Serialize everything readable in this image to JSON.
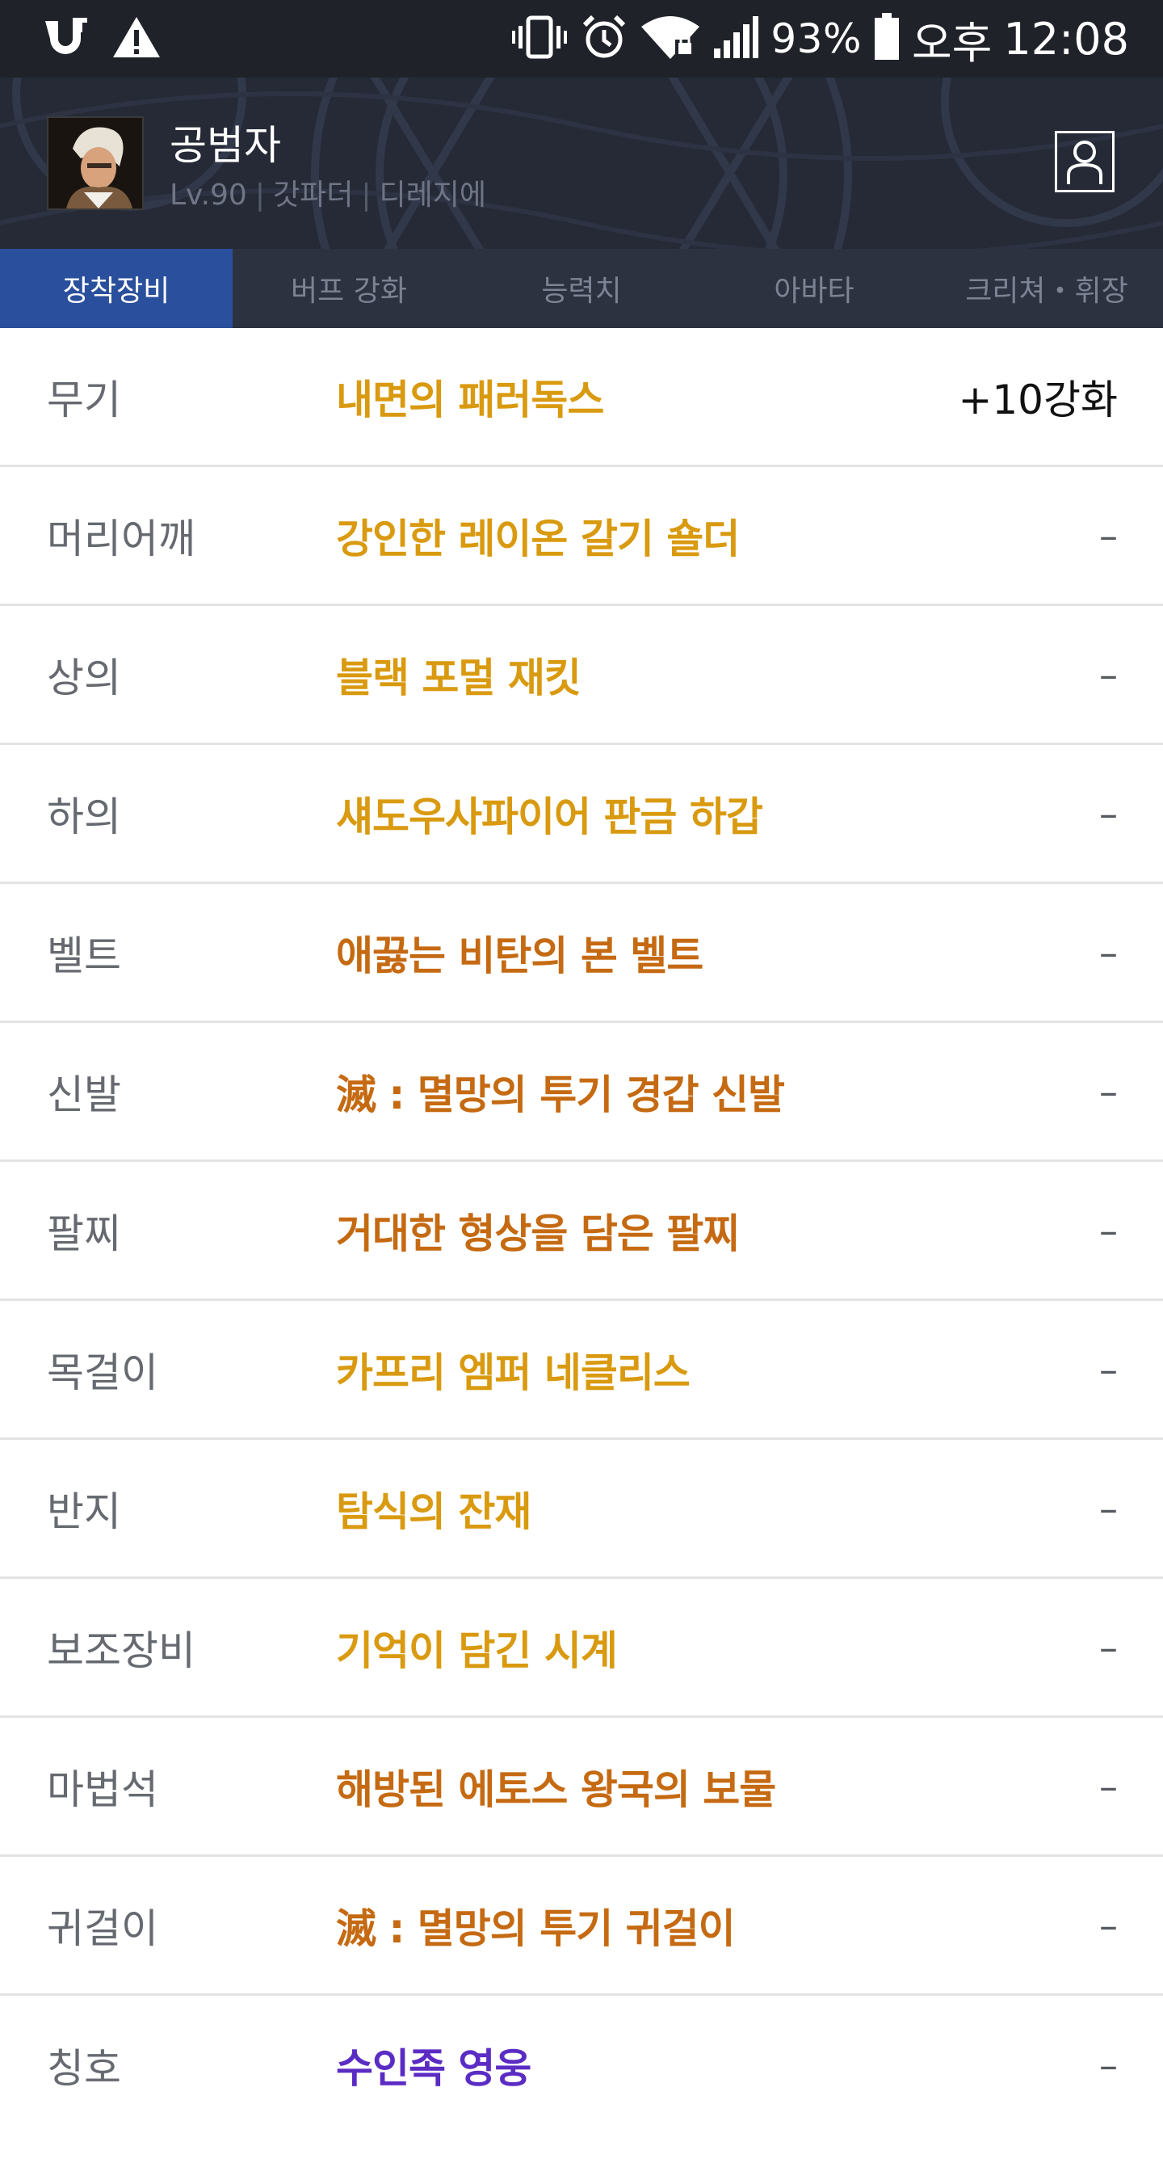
{
  "status_bar": {
    "battery_percent": "93%",
    "period": "오후",
    "time": "12:08"
  },
  "character": {
    "name": "공범자",
    "level": "Lv.90",
    "class": "갓파더",
    "server": "디레지에"
  },
  "tabs": [
    {
      "label": "장착장비",
      "active": true
    },
    {
      "label": "버프 강화",
      "active": false
    },
    {
      "label": "능력치",
      "active": false
    },
    {
      "label": "아바타",
      "active": false
    },
    {
      "label": "크리쳐・휘장",
      "active": false
    }
  ],
  "colors": {
    "legendary": "#d99a10",
    "epic": "#c56a12",
    "unique": "#5b2cc4"
  },
  "equipment": [
    {
      "slot": "무기",
      "item": "내면의 패러독스",
      "enhance": "+10강화",
      "color": "#d99a10"
    },
    {
      "slot": "머리어깨",
      "item": "강인한 레이온 갈기 숄더",
      "enhance": "–",
      "color": "#d99a10"
    },
    {
      "slot": "상의",
      "item": "블랙 포멀 재킷",
      "enhance": "–",
      "color": "#d99a10"
    },
    {
      "slot": "하의",
      "item": "섀도우사파이어 판금 하갑",
      "enhance": "–",
      "color": "#d99a10"
    },
    {
      "slot": "벨트",
      "item": "애끓는 비탄의 본 벨트",
      "enhance": "–",
      "color": "#c56a12"
    },
    {
      "slot": "신발",
      "item": "滅 : 멸망의 투기 경갑 신발",
      "enhance": "–",
      "color": "#c56a12"
    },
    {
      "slot": "팔찌",
      "item": "거대한 형상을 담은 팔찌",
      "enhance": "–",
      "color": "#c56a12"
    },
    {
      "slot": "목걸이",
      "item": "카프리 엠퍼 네클리스",
      "enhance": "–",
      "color": "#d99a10"
    },
    {
      "slot": "반지",
      "item": "탐식의 잔재",
      "enhance": "–",
      "color": "#d99a10"
    },
    {
      "slot": "보조장비",
      "item": "기억이 담긴 시계",
      "enhance": "–",
      "color": "#d99a10"
    },
    {
      "slot": "마법석",
      "item": "해방된 에토스 왕국의 보물",
      "enhance": "–",
      "color": "#c56a12"
    },
    {
      "slot": "귀걸이",
      "item": "滅 : 멸망의 투기 귀걸이",
      "enhance": "–",
      "color": "#c56a12"
    },
    {
      "slot": "칭호",
      "item": "수인족 영웅",
      "enhance": "–",
      "color": "#5b2cc4"
    }
  ]
}
